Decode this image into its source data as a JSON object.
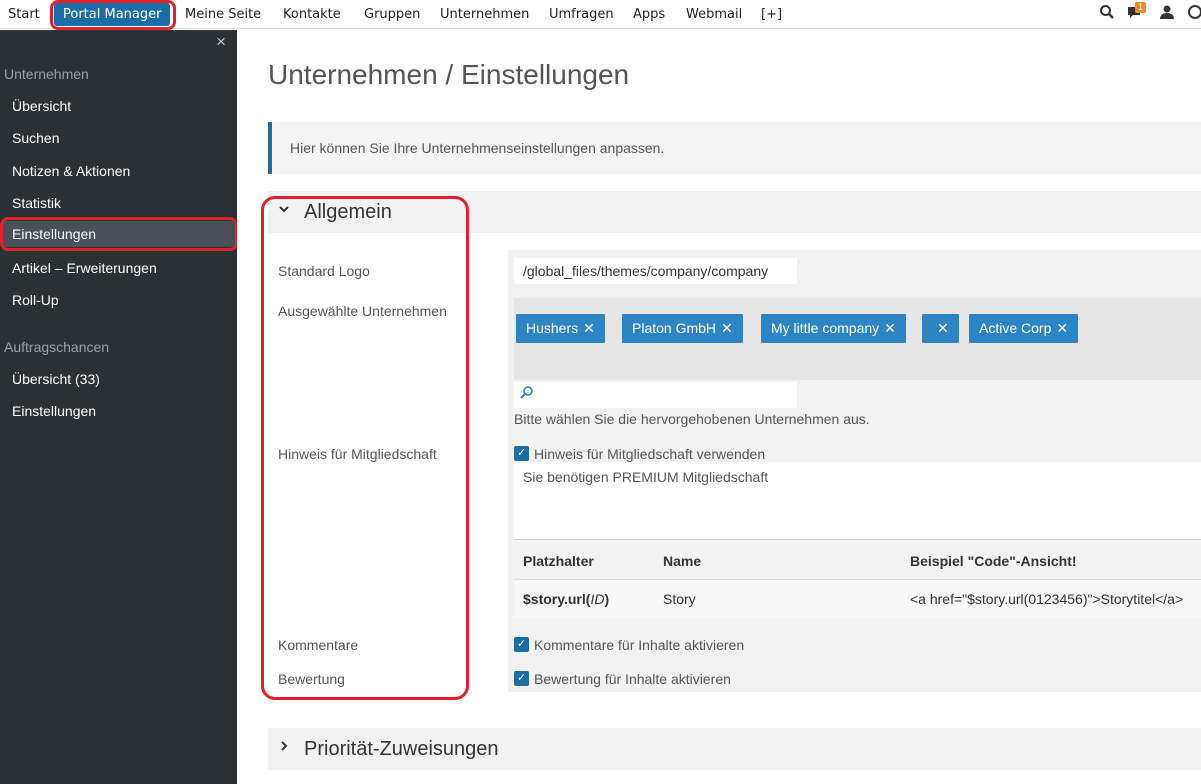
{
  "nav": {
    "items": [
      "Start",
      "Portal Manager",
      "Meine Seite",
      "Kontakte",
      "Gruppen",
      "Unternehmen",
      "Umfragen",
      "Apps",
      "Webmail",
      "[+]"
    ],
    "notification_count": "1",
    "icons": [
      "search-icon",
      "chat-icon",
      "user-icon"
    ]
  },
  "sidebar": {
    "close_icon": "×",
    "group1": "Unternehmen",
    "group1_items": [
      "Übersicht",
      "Suchen",
      "Notizen & Aktionen",
      "Statistik",
      "Einstellungen",
      "Artikel – Erweiterungen",
      "Roll-Up"
    ],
    "group2": "Auftragschancen",
    "group2_items": [
      "Übersicht (33)",
      "Einstellungen"
    ]
  },
  "page": {
    "title": "Unternehmen / Einstellungen",
    "info": "Hier können Sie Ihre Unternehmenseinstellungen anpassen."
  },
  "section_general": {
    "title": "Allgemein",
    "labels": {
      "logo": "Standard Logo",
      "companies": "Ausgewählte Unternehmen",
      "membership": "Hinweis für Mitgliedschaft",
      "comments": "Kommentare",
      "rating": "Bewertung"
    },
    "logo_value": "/global_files/themes/company/company",
    "tags": [
      "Hushers",
      "Platon GmbH",
      "My little company",
      "",
      "Active Corp"
    ],
    "tag_remove": "✕",
    "companies_help": "Bitte wählen Sie die hervorgehobenen Unternehmen aus.",
    "membership_checkbox": "Hinweis für Mitgliedschaft verwenden",
    "membership_text": "Sie benötigen PREMIUM Mitgliedschaft",
    "table": {
      "headers": [
        "Platzhalter",
        "Name",
        "Beispiel \"Code\"-Ansicht!"
      ],
      "row": {
        "placeholder_bold": "$story.url(",
        "placeholder_italic": "ID",
        "placeholder_end": ")",
        "name": "Story",
        "example": "<a href=\"$story.url(0123456)\">Storytitel</a>"
      }
    },
    "comments_checkbox": "Kommentare für Inhalte aktivieren",
    "rating_checkbox": "Bewertung für Inhalte aktivieren"
  },
  "section_priority": {
    "title": "Priorität-Zuweisungen"
  },
  "colors": {
    "accent": "#1a6ea8",
    "tag": "#2c84c5",
    "sidebar": "#2b3035",
    "highlight": "#e0202c"
  }
}
